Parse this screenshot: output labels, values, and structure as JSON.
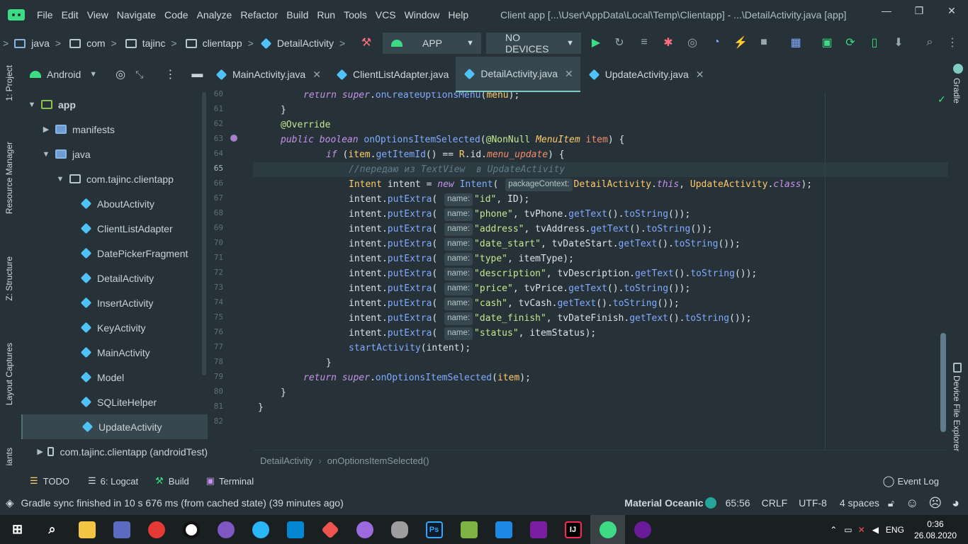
{
  "menubar": {
    "items": [
      "File",
      "Edit",
      "View",
      "Navigate",
      "Code",
      "Analyze",
      "Refactor",
      "Build",
      "Run",
      "Tools",
      "VCS",
      "Window",
      "Help"
    ],
    "title": "Client app [...\\User\\AppData\\Local\\Temp\\Clientapp] - ...\\DetailActivity.java [app]"
  },
  "nav": {
    "crumbs": [
      "java",
      "com",
      "tajinc",
      "clientapp",
      "DetailActivity"
    ],
    "config": "APP",
    "device": "NO DEVICES"
  },
  "sidebar_tabs": {
    "project": "1: Project",
    "resource": "Resource Manager",
    "structure": "Z: Structure",
    "layout": "Layout Captures",
    "variants": "iants"
  },
  "right_tabs": {
    "gradle": "Gradle",
    "device_explorer": "Device File Explorer"
  },
  "project": {
    "view": "Android",
    "tree": [
      {
        "label": "app",
        "level": 0,
        "arrow": "down",
        "bold": true
      },
      {
        "label": "manifests",
        "level": 1,
        "arrow": "right"
      },
      {
        "label": "java",
        "level": 1,
        "arrow": "down"
      },
      {
        "label": "com.tajinc.clientapp",
        "level": 2,
        "arrow": "down"
      },
      {
        "label": "AboutActivity",
        "level": 3
      },
      {
        "label": "ClientListAdapter",
        "level": 3
      },
      {
        "label": "DatePickerFragment",
        "level": 3
      },
      {
        "label": "DetailActivity",
        "level": 3
      },
      {
        "label": "InsertActivity",
        "level": 3
      },
      {
        "label": "KeyActivity",
        "level": 3
      },
      {
        "label": "MainActivity",
        "level": 3
      },
      {
        "label": "Model",
        "level": 3
      },
      {
        "label": "SQLiteHelper",
        "level": 3
      },
      {
        "label": "UpdateActivity",
        "level": 3,
        "selected": true
      },
      {
        "label": "com.tajinc.clientapp (androidTest)",
        "level": 2,
        "arrow": "right"
      }
    ]
  },
  "tabs": [
    {
      "label": "MainActivity.java",
      "active": false
    },
    {
      "label": "ClientListAdapter.java",
      "active": false
    },
    {
      "label": "DetailActivity.java",
      "active": true
    },
    {
      "label": "UpdateActivity.java",
      "active": false
    }
  ],
  "editor": {
    "line_numbers": [
      "60",
      "61",
      "62",
      "63",
      "64",
      "65",
      "66",
      "67",
      "68",
      "69",
      "70",
      "71",
      "72",
      "73",
      "74",
      "75",
      "76",
      "77",
      "78",
      "79",
      "80",
      "81",
      "82"
    ],
    "comment": "//передаю из TextView  в UpdateActivity",
    "hint_context": "packageContext:",
    "hint_name": "name:",
    "breadcrumb": [
      "DetailActivity",
      "onOptionsItemSelected()"
    ]
  },
  "toolwindows": {
    "todo": "TODO",
    "logcat": "6: Logcat",
    "build": "Build",
    "terminal": "Terminal",
    "eventlog": "Event Log"
  },
  "status": {
    "message": "Gradle sync finished in 10 s 676 ms (from cached state) (39 minutes ago)",
    "theme": "Material Oceanic",
    "position": "65:56",
    "line_sep": "CRLF",
    "encoding": "UTF-8",
    "indent": "4 spaces"
  },
  "taskbar": {
    "lang": "ENG",
    "time": "0:36",
    "date": "26.08.2020"
  },
  "colors": {
    "bg": "#263238",
    "accent": "#80cbc4",
    "keyword": "#c792ea",
    "type": "#ffcb6b",
    "method": "#82aaff",
    "string": "#c3e88d"
  }
}
